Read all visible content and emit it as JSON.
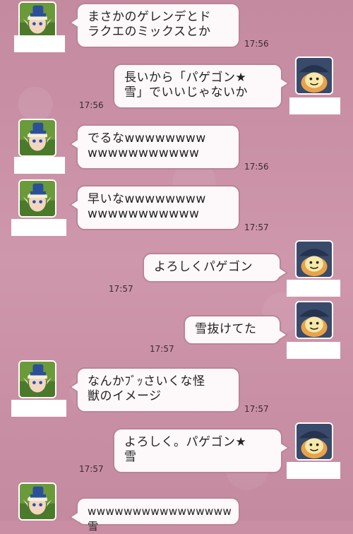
{
  "messages": [
    {
      "side": "left",
      "text": "まさかのゲレンデとド\nラクエのミックスとか",
      "time": "17:56"
    },
    {
      "side": "right",
      "text": "長いから「パゲゴン★\n雪」でいいじゃないか",
      "time": "17:56"
    },
    {
      "side": "left",
      "text": "でるなwwwwwwww\nwwwwwwwwwww",
      "time": "17:56"
    },
    {
      "side": "left",
      "text": "早いなwwwwwwww\nwwwwwwwwwww",
      "time": "17:57"
    },
    {
      "side": "right",
      "text": "よろしくパゲゴン",
      "time": "17:57"
    },
    {
      "side": "right",
      "text": "雪抜けてた",
      "time": "17:57"
    },
    {
      "side": "left",
      "text": "なんかﾌﾞｯさいくな怪\n獣のイメージ",
      "time": "17:57"
    },
    {
      "side": "right",
      "text": "よろしく。パゲゴン★\n雪",
      "time": "17:57"
    },
    {
      "side": "left",
      "text": "wwwwwwwwwwwwwwww雪",
      "time": ""
    }
  ],
  "colors": {
    "background": "#c98ea3",
    "bubble": "#fdf8fa",
    "bubble_border": "#b98496"
  },
  "icons": {
    "left_avatar": "elf-boy-blue-hat-avatar",
    "right_avatar": "pumpkin-slime-witch-hat-avatar"
  }
}
